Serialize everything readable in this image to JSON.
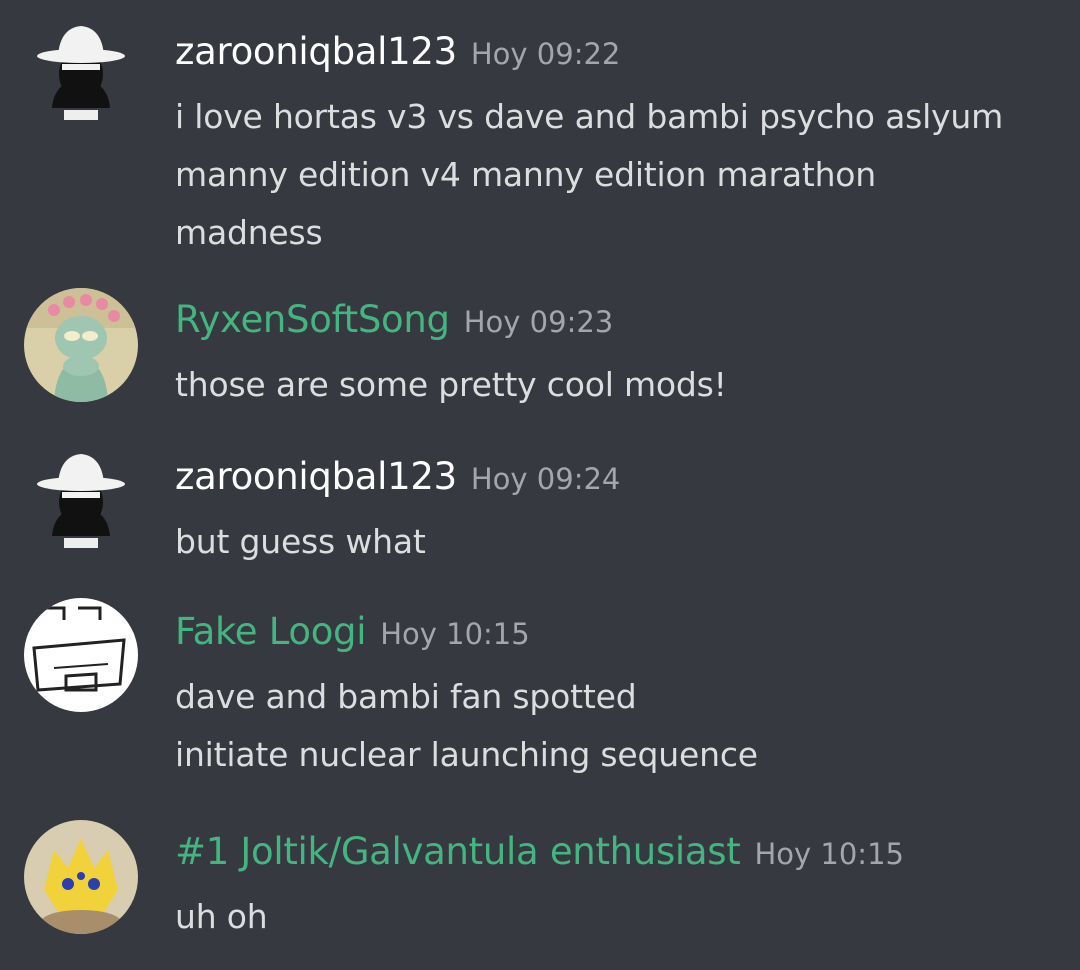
{
  "colors": {
    "background": "#36393f",
    "text": "#dcddde",
    "timestamp": "#a3a6aa",
    "username_default": "#ffffff",
    "username_green": "#43b581"
  },
  "messages": [
    {
      "username": "zarooniqbal123",
      "name_color": "#ffffff",
      "avatar_icon": "white-hat-silhouette-avatar",
      "timestamp": "Hoy 09:22",
      "lines": [
        "i love hortas v3 vs dave and bambi psycho aslyum",
        "manny edition v4 manny edition marathon",
        "madness"
      ]
    },
    {
      "username": "RyxenSoftSong",
      "name_color": "#43b581",
      "avatar_icon": "squidward-flower-crown-avatar",
      "timestamp": "Hoy 09:23",
      "lines": [
        "those are some pretty cool mods!"
      ]
    },
    {
      "username": "zarooniqbal123",
      "name_color": "#ffffff",
      "avatar_icon": "white-hat-silhouette-avatar",
      "timestamp": "Hoy 09:24",
      "lines": [
        "but guess what"
      ]
    },
    {
      "username": "Fake Loogi",
      "name_color": "#43b581",
      "avatar_icon": "sketch-face-avatar",
      "timestamp": "Hoy 10:15",
      "lines": [
        "dave and bambi fan spotted",
        "initiate nuclear launching sequence"
      ]
    },
    {
      "username": "#1 Joltik/Galvantula enthusiast",
      "name_color": "#43b581",
      "avatar_icon": "joltik-avatar",
      "timestamp": "Hoy 10:15",
      "lines": [
        "uh oh"
      ]
    }
  ]
}
